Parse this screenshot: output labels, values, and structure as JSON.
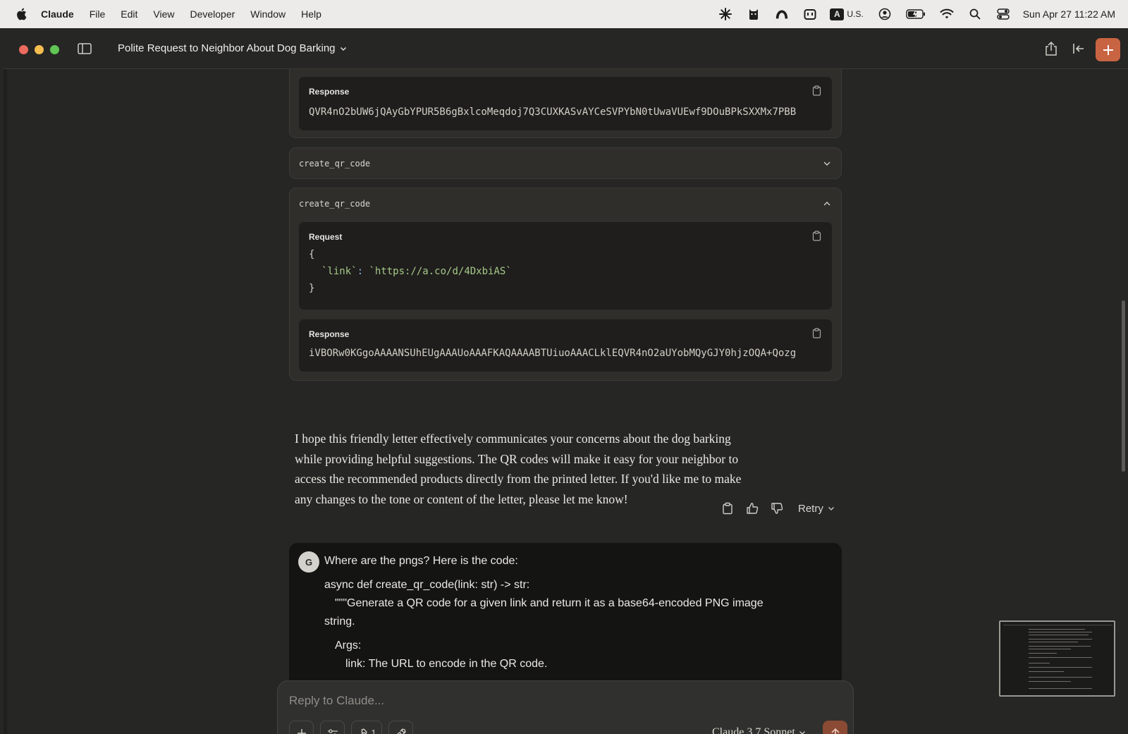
{
  "menubar": {
    "app": "Claude",
    "items": [
      "File",
      "Edit",
      "View",
      "Developer",
      "Window",
      "Help"
    ],
    "input_source_letter": "A",
    "input_source": "U.S.",
    "clock": "Sun Apr 27  11:22 AM"
  },
  "window": {
    "title": "Polite Request to Neighbor About Dog Barking"
  },
  "tools": {
    "first_response_label": "Response",
    "first_response_value": "QVR4nO2bUW6jQAyGbYPUR5B6gBxlcoMeqdoj7Q3CUXKASvAYCeSVPYbN0tUwaVUEwf9DOuBPkSXXMx7PBB",
    "collapsed_call_name": "create_qr_code",
    "expanded_call_name": "create_qr_code",
    "request_label": "Request",
    "request_open": "{",
    "request_key": "`link`",
    "request_colon": ":",
    "request_value": "`https://a.co/d/4DxbiAS`",
    "request_close": "}",
    "response_label": "Response",
    "response_value": "iVBORw0KGgoAAAANSUhEUgAAAUoAAAFKAQAAAABTUiuoAAACLklEQVR4nO2aUYobMQyGJY0hjzOQA+Qozg"
  },
  "assistant": {
    "lines": [
      "I hope this friendly letter effectively communicates your concerns about the dog barking",
      "while providing helpful suggestions. The QR codes will make it easy for your neighbor to",
      "access the recommended products directly from the printed letter. If you'd like me to make",
      "any changes to the tone or content of the letter, please let me know!"
    ],
    "retry_label": "Retry"
  },
  "user": {
    "avatar_initial": "G",
    "lines": [
      "Where are the pngs? Here is the code:",
      "async def create_qr_code(link: str) -> str:",
      "\"\"\"Generate a QR code for a given link and return it as a base64-encoded PNG image",
      "string.",
      "Args:",
      "link: The URL to encode in the QR code."
    ]
  },
  "composer": {
    "placeholder": "Reply to Claude...",
    "tools_count": "1",
    "model": "Claude 3.7 Sonnet"
  },
  "colors": {
    "accent": "#c96442",
    "background": "#262624",
    "user_bubble": "#141413"
  }
}
